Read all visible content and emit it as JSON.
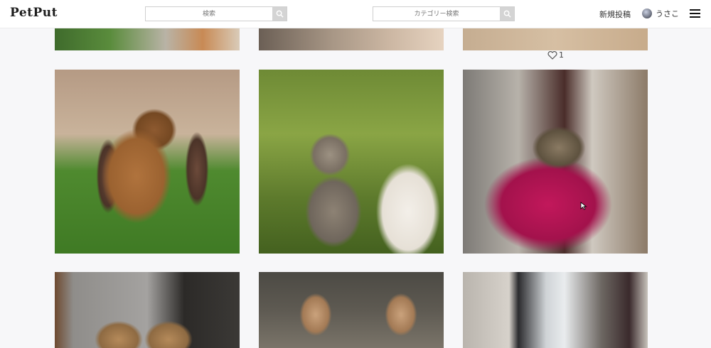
{
  "header": {
    "logo": "PetPut",
    "search_placeholder": "検索",
    "category_search_placeholder": "カテゴリー検索",
    "new_post_label": "新規投稿",
    "username": "うさこ"
  },
  "posts": {
    "like_count": "1",
    "items": [
      {
        "icon": "rabbit-photo"
      },
      {
        "icon": "kitten-photo"
      },
      {
        "icon": "turtle-photo"
      },
      {
        "icon": "deer-photo"
      },
      {
        "icon": "tabby-cat-photo"
      },
      {
        "icon": "room-photo"
      }
    ]
  },
  "colors": {
    "header_bg": "#ffffff",
    "page_bg": "#f7f7f9",
    "search_button": "#d4d4d4"
  }
}
